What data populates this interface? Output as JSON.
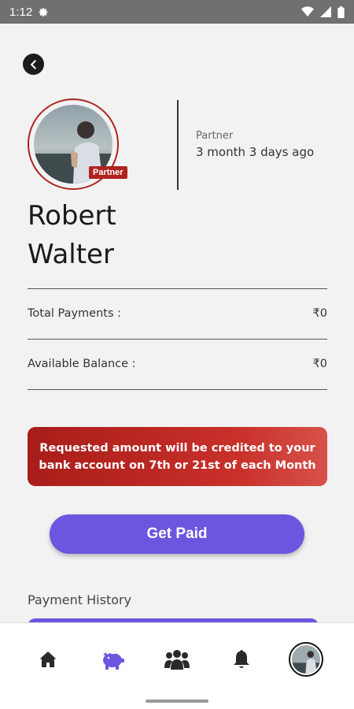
{
  "status_bar": {
    "time": "1:12"
  },
  "profile": {
    "badge": "Partner",
    "role": "Partner",
    "duration": "3 month 3 days ago",
    "first_name": "Robert",
    "last_name": "Walter"
  },
  "summary": {
    "total_payments_label": "Total Payments :",
    "total_payments_value": "₹0",
    "available_balance_label": "Available Balance :",
    "available_balance_value": "₹0"
  },
  "notice": {
    "line1": "Requested amount will be credited to your",
    "line2": "bank account on 7th or 21st of each Month"
  },
  "actions": {
    "get_paid_label": "Get Paid"
  },
  "history": {
    "title": "Payment History"
  },
  "colors": {
    "accent": "#6d55e0",
    "brand_red": "#b0231f"
  },
  "nav": {
    "items": [
      {
        "icon": "home-icon",
        "active": false
      },
      {
        "icon": "piggy-bank-icon",
        "active": true
      },
      {
        "icon": "users-icon",
        "active": false
      },
      {
        "icon": "bell-icon",
        "active": false
      },
      {
        "icon": "profile-avatar",
        "active": false
      }
    ]
  }
}
